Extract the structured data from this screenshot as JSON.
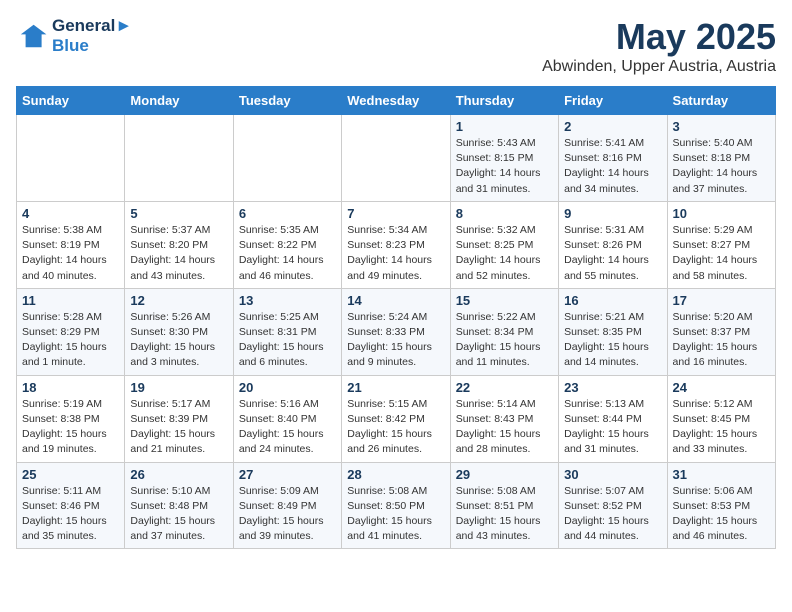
{
  "header": {
    "logo_line1": "General",
    "logo_line2": "Blue",
    "title": "May 2025",
    "subtitle": "Abwinden, Upper Austria, Austria"
  },
  "weekdays": [
    "Sunday",
    "Monday",
    "Tuesday",
    "Wednesday",
    "Thursday",
    "Friday",
    "Saturday"
  ],
  "weeks": [
    [
      {
        "day": "",
        "info": ""
      },
      {
        "day": "",
        "info": ""
      },
      {
        "day": "",
        "info": ""
      },
      {
        "day": "",
        "info": ""
      },
      {
        "day": "1",
        "info": "Sunrise: 5:43 AM\nSunset: 8:15 PM\nDaylight: 14 hours\nand 31 minutes."
      },
      {
        "day": "2",
        "info": "Sunrise: 5:41 AM\nSunset: 8:16 PM\nDaylight: 14 hours\nand 34 minutes."
      },
      {
        "day": "3",
        "info": "Sunrise: 5:40 AM\nSunset: 8:18 PM\nDaylight: 14 hours\nand 37 minutes."
      }
    ],
    [
      {
        "day": "4",
        "info": "Sunrise: 5:38 AM\nSunset: 8:19 PM\nDaylight: 14 hours\nand 40 minutes."
      },
      {
        "day": "5",
        "info": "Sunrise: 5:37 AM\nSunset: 8:20 PM\nDaylight: 14 hours\nand 43 minutes."
      },
      {
        "day": "6",
        "info": "Sunrise: 5:35 AM\nSunset: 8:22 PM\nDaylight: 14 hours\nand 46 minutes."
      },
      {
        "day": "7",
        "info": "Sunrise: 5:34 AM\nSunset: 8:23 PM\nDaylight: 14 hours\nand 49 minutes."
      },
      {
        "day": "8",
        "info": "Sunrise: 5:32 AM\nSunset: 8:25 PM\nDaylight: 14 hours\nand 52 minutes."
      },
      {
        "day": "9",
        "info": "Sunrise: 5:31 AM\nSunset: 8:26 PM\nDaylight: 14 hours\nand 55 minutes."
      },
      {
        "day": "10",
        "info": "Sunrise: 5:29 AM\nSunset: 8:27 PM\nDaylight: 14 hours\nand 58 minutes."
      }
    ],
    [
      {
        "day": "11",
        "info": "Sunrise: 5:28 AM\nSunset: 8:29 PM\nDaylight: 15 hours\nand 1 minute."
      },
      {
        "day": "12",
        "info": "Sunrise: 5:26 AM\nSunset: 8:30 PM\nDaylight: 15 hours\nand 3 minutes."
      },
      {
        "day": "13",
        "info": "Sunrise: 5:25 AM\nSunset: 8:31 PM\nDaylight: 15 hours\nand 6 minutes."
      },
      {
        "day": "14",
        "info": "Sunrise: 5:24 AM\nSunset: 8:33 PM\nDaylight: 15 hours\nand 9 minutes."
      },
      {
        "day": "15",
        "info": "Sunrise: 5:22 AM\nSunset: 8:34 PM\nDaylight: 15 hours\nand 11 minutes."
      },
      {
        "day": "16",
        "info": "Sunrise: 5:21 AM\nSunset: 8:35 PM\nDaylight: 15 hours\nand 14 minutes."
      },
      {
        "day": "17",
        "info": "Sunrise: 5:20 AM\nSunset: 8:37 PM\nDaylight: 15 hours\nand 16 minutes."
      }
    ],
    [
      {
        "day": "18",
        "info": "Sunrise: 5:19 AM\nSunset: 8:38 PM\nDaylight: 15 hours\nand 19 minutes."
      },
      {
        "day": "19",
        "info": "Sunrise: 5:17 AM\nSunset: 8:39 PM\nDaylight: 15 hours\nand 21 minutes."
      },
      {
        "day": "20",
        "info": "Sunrise: 5:16 AM\nSunset: 8:40 PM\nDaylight: 15 hours\nand 24 minutes."
      },
      {
        "day": "21",
        "info": "Sunrise: 5:15 AM\nSunset: 8:42 PM\nDaylight: 15 hours\nand 26 minutes."
      },
      {
        "day": "22",
        "info": "Sunrise: 5:14 AM\nSunset: 8:43 PM\nDaylight: 15 hours\nand 28 minutes."
      },
      {
        "day": "23",
        "info": "Sunrise: 5:13 AM\nSunset: 8:44 PM\nDaylight: 15 hours\nand 31 minutes."
      },
      {
        "day": "24",
        "info": "Sunrise: 5:12 AM\nSunset: 8:45 PM\nDaylight: 15 hours\nand 33 minutes."
      }
    ],
    [
      {
        "day": "25",
        "info": "Sunrise: 5:11 AM\nSunset: 8:46 PM\nDaylight: 15 hours\nand 35 minutes."
      },
      {
        "day": "26",
        "info": "Sunrise: 5:10 AM\nSunset: 8:48 PM\nDaylight: 15 hours\nand 37 minutes."
      },
      {
        "day": "27",
        "info": "Sunrise: 5:09 AM\nSunset: 8:49 PM\nDaylight: 15 hours\nand 39 minutes."
      },
      {
        "day": "28",
        "info": "Sunrise: 5:08 AM\nSunset: 8:50 PM\nDaylight: 15 hours\nand 41 minutes."
      },
      {
        "day": "29",
        "info": "Sunrise: 5:08 AM\nSunset: 8:51 PM\nDaylight: 15 hours\nand 43 minutes."
      },
      {
        "day": "30",
        "info": "Sunrise: 5:07 AM\nSunset: 8:52 PM\nDaylight: 15 hours\nand 44 minutes."
      },
      {
        "day": "31",
        "info": "Sunrise: 5:06 AM\nSunset: 8:53 PM\nDaylight: 15 hours\nand 46 minutes."
      }
    ]
  ]
}
